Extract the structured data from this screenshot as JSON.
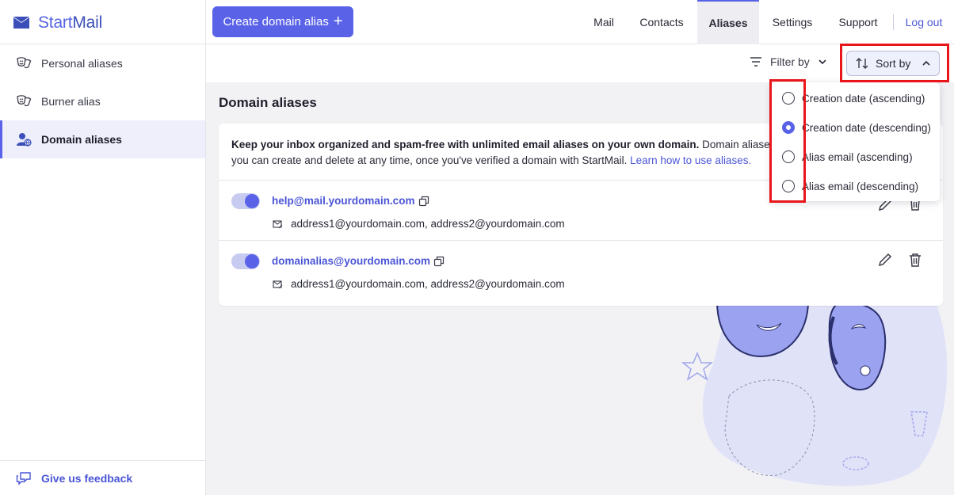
{
  "app": {
    "logo_start": "Start",
    "logo_mail": "Mail"
  },
  "sidebar": {
    "items": [
      {
        "label": "Personal aliases"
      },
      {
        "label": "Burner alias"
      },
      {
        "label": "Domain aliases"
      }
    ],
    "feedback_label": "Give us feedback"
  },
  "topbar": {
    "create_label": "Create domain alias",
    "nav": [
      {
        "label": "Mail"
      },
      {
        "label": "Contacts"
      },
      {
        "label": "Aliases"
      },
      {
        "label": "Settings"
      },
      {
        "label": "Support"
      }
    ],
    "logout_label": "Log out"
  },
  "subbar": {
    "filter_label": "Filter by",
    "sort_label": "Sort by"
  },
  "main": {
    "title": "Domain aliases",
    "intro_bold": "Keep your inbox organized and spam-free with unlimited email aliases on your own domain.",
    "intro_rest": " Domain aliases",
    "intro_line2": "you can create and delete at any time, once you've verified a domain with StartMail. ",
    "intro_link": "Learn how to use aliases.",
    "aliases": [
      {
        "email": "help@mail.yourdomain.com",
        "forward": "address1@yourdomain.com, address2@yourdomain.com",
        "enabled": true
      },
      {
        "email": "domainalias@yourdomain.com",
        "forward": "address1@yourdomain.com, address2@yourdomain.com",
        "enabled": true
      }
    ]
  },
  "sort_menu": {
    "options": [
      {
        "label": "Creation date (ascending)",
        "selected": false
      },
      {
        "label": "Creation date (descending)",
        "selected": true
      },
      {
        "label": "Alias email (ascending)",
        "selected": false
      },
      {
        "label": "Alias email (descending)",
        "selected": false
      }
    ]
  },
  "colors": {
    "accent": "#5a63e8",
    "link": "#4a55d6",
    "highlight": "#e8151b"
  }
}
